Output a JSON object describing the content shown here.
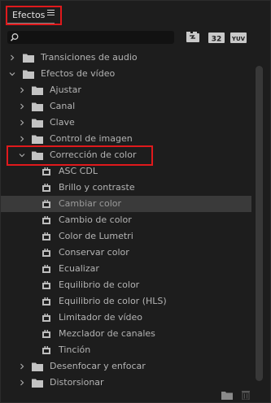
{
  "panel": {
    "tab_title": "Efectos",
    "menu_icon": "hamburger-menu-icon"
  },
  "search": {
    "value": "",
    "placeholder": "",
    "icon": "search-icon"
  },
  "filters": {
    "accelerated_icon": "accelerated-effects-icon",
    "bit32_label": "32",
    "yuv_label": "YUV"
  },
  "tree": [
    {
      "label": "Transiciones de audio",
      "type": "folder",
      "level": 0,
      "expanded": false
    },
    {
      "label": "Efectos de vídeo",
      "type": "folder",
      "level": 0,
      "expanded": true
    },
    {
      "label": "Ajustar",
      "type": "folder",
      "level": 1,
      "expanded": false
    },
    {
      "label": "Canal",
      "type": "folder",
      "level": 1,
      "expanded": false
    },
    {
      "label": "Clave",
      "type": "folder",
      "level": 1,
      "expanded": false
    },
    {
      "label": "Control de imagen",
      "type": "folder",
      "level": 1,
      "expanded": false
    },
    {
      "label": "Corrección de color",
      "type": "folder",
      "level": 1,
      "expanded": true,
      "highlighted": true
    },
    {
      "label": "ASC CDL",
      "type": "effect",
      "level": 2
    },
    {
      "label": "Brillo y contraste",
      "type": "effect",
      "level": 2
    },
    {
      "label": "Cambiar color",
      "type": "effect",
      "level": 2,
      "selected": true
    },
    {
      "label": "Cambio de color",
      "type": "effect",
      "level": 2
    },
    {
      "label": "Color de Lumetri",
      "type": "effect",
      "level": 2
    },
    {
      "label": "Conservar color",
      "type": "effect",
      "level": 2
    },
    {
      "label": "Ecualizar",
      "type": "effect",
      "level": 2
    },
    {
      "label": "Equilibrio de color",
      "type": "effect",
      "level": 2
    },
    {
      "label": "Equilibrio de color (HLS)",
      "type": "effect",
      "level": 2
    },
    {
      "label": "Limitador de vídeo",
      "type": "effect",
      "level": 2
    },
    {
      "label": "Mezclador de canales",
      "type": "effect",
      "level": 2
    },
    {
      "label": "Tinción",
      "type": "effect",
      "level": 2
    },
    {
      "label": "Desenfocar y enfocar",
      "type": "folder",
      "level": 1,
      "expanded": false
    },
    {
      "label": "Distorsionar",
      "type": "folder",
      "level": 1,
      "expanded": false
    }
  ],
  "bottom": {
    "new_bin_icon": "new-folder-icon",
    "delete_icon": "trash-icon"
  },
  "colors": {
    "highlight": "#e0191c",
    "background": "#1d1d1d",
    "selected_row": "#3a3a3a"
  }
}
